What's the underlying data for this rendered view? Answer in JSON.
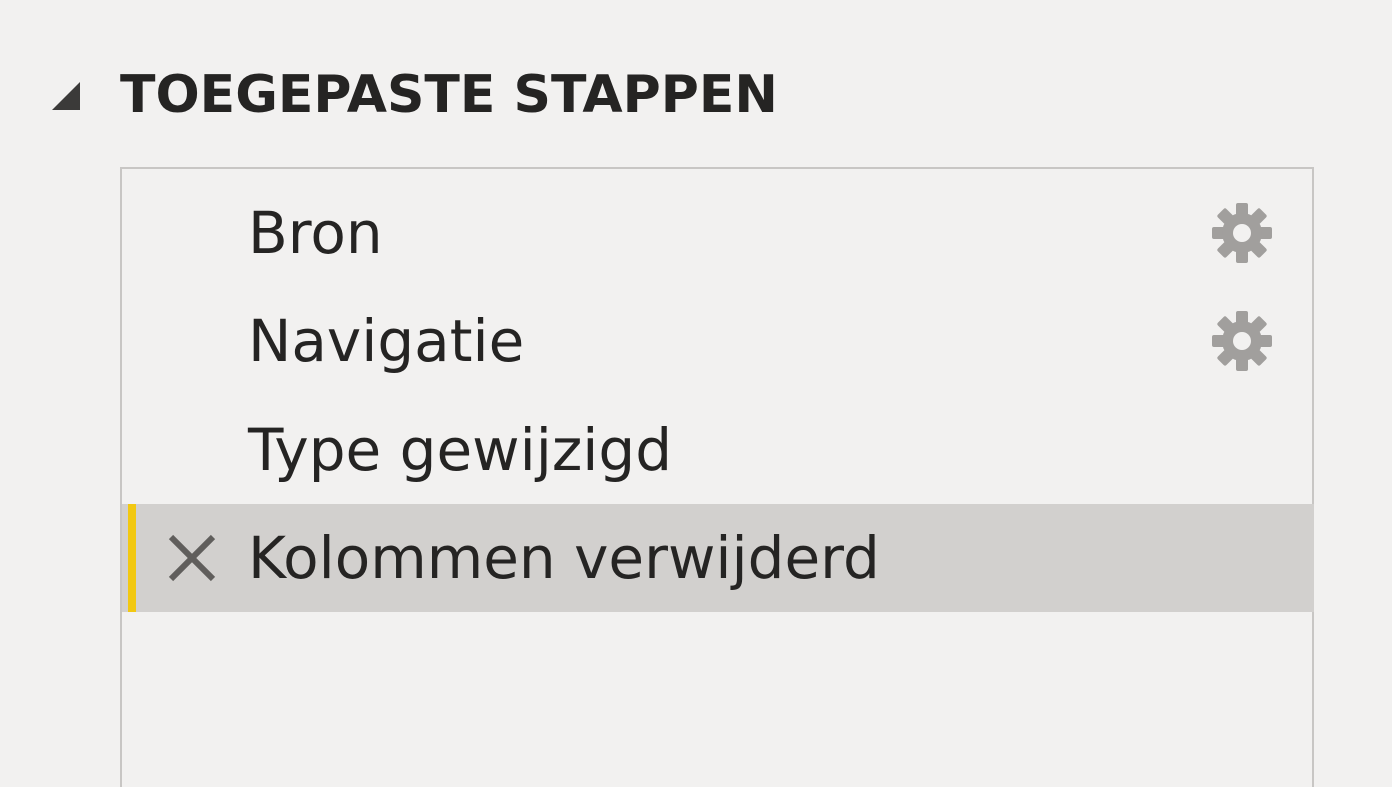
{
  "panel": {
    "section_title": "TOEGEPASTE STAPPEN",
    "collapse_icon": "triangle-collapse-icon"
  },
  "steps": [
    {
      "label": "Bron",
      "has_settings": true,
      "selected": false
    },
    {
      "label": "Navigatie",
      "has_settings": true,
      "selected": false
    },
    {
      "label": "Type gewijzigd",
      "has_settings": false,
      "selected": false
    },
    {
      "label": "Kolommen verwijderd",
      "has_settings": false,
      "selected": true
    }
  ],
  "icons": {
    "settings": "gear-icon",
    "delete": "close-icon"
  },
  "colors": {
    "background": "#f2f1f0",
    "selected_row": "#d2d0ce",
    "selected_accent": "#f2c811",
    "gear": "#a19f9d",
    "text": "#252423"
  }
}
